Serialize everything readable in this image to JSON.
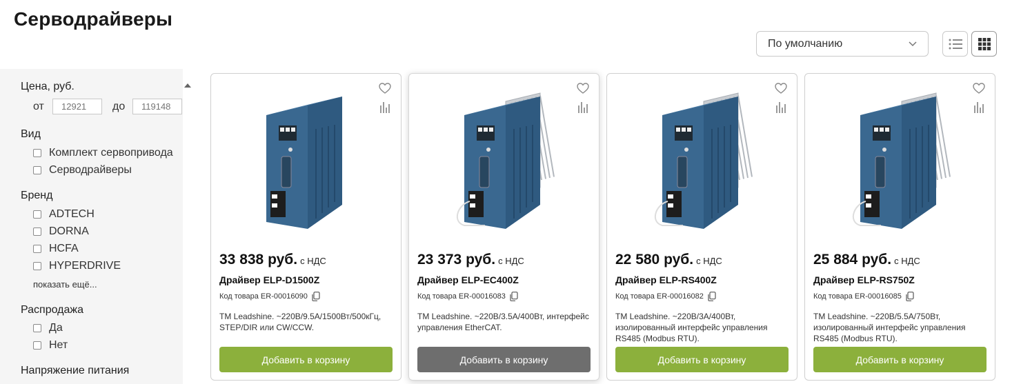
{
  "page": {
    "title": "Серводрайверы"
  },
  "toolbar": {
    "sort_value": "По умолчанию",
    "list_view_icon": "list-view-icon",
    "grid_view_icon": "grid-view-icon"
  },
  "filters": {
    "price": {
      "title": "Цена, руб.",
      "from_label": "от",
      "to_label": "до",
      "from_placeholder": "12921",
      "to_placeholder": "119148"
    },
    "kind": {
      "title": "Вид",
      "options": [
        "Комплект сервопривода",
        "Серводрайверы"
      ]
    },
    "brand": {
      "title": "Бренд",
      "options": [
        "ADTECH",
        "DORNA",
        "HCFA",
        "HYPERDRIVE"
      ],
      "show_more": "показать ещё..."
    },
    "sale": {
      "title": "Распродажа",
      "options": [
        "Да",
        "Нет"
      ]
    },
    "voltage": {
      "title": "Напряжение питания"
    }
  },
  "colors": {
    "accent_green": "#8cb03c",
    "hover_button": "#6e6e6e",
    "product_blue": "#3e6a92"
  },
  "products": [
    {
      "price": "33 838 руб.",
      "vat": "с НДС",
      "name": "Драйвер ELP-D1500Z",
      "code": "Код товара ER-00016090",
      "desc": "TM Leadshine. ~220В/9.5А/1500Вт/500кГц, STEP/DIR или CW/CCW.",
      "button": "Добавить в корзину"
    },
    {
      "price": "23 373 руб.",
      "vat": "с НДС",
      "name": "Драйвер ELP-EC400Z",
      "code": "Код товара ER-00016083",
      "desc": "TM Leadshine. ~220В/3.5А/400Вт, интерфейс управления EtherCAT.",
      "button": "Добавить в корзину"
    },
    {
      "price": "22 580 руб.",
      "vat": "с НДС",
      "name": "Драйвер ELP-RS400Z",
      "code": "Код товара ER-00016082",
      "desc": "TM Leadshine. ~220В/3А/400Вт, изолированный интерфейс управления RS485 (Modbus RTU).",
      "button": "Добавить в корзину"
    },
    {
      "price": "25 884 руб.",
      "vat": "с НДС",
      "name": "Драйвер ELP-RS750Z",
      "code": "Код товара ER-00016085",
      "desc": "TM Leadshine. ~220В/5.5А/750Вт, изолированный интерфейс управления RS485 (Modbus RTU).",
      "button": "Добавить в корзину"
    }
  ]
}
